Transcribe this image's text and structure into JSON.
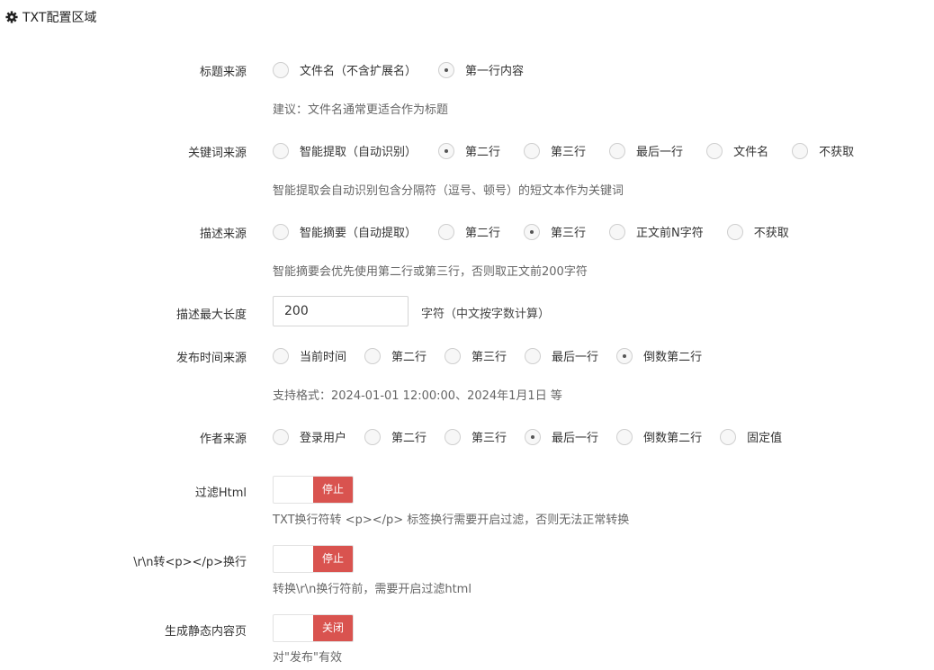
{
  "section": {
    "title": "TXT配置区域",
    "icon": "gear-icon"
  },
  "colors": {
    "accent_red": "#d9534f",
    "help_text": "#666666",
    "label_text": "#333333"
  },
  "title_source": {
    "label": "标题来源",
    "options": [
      {
        "label": "文件名（不含扩展名）",
        "checked": false
      },
      {
        "label": "第一行内容",
        "checked": true
      }
    ],
    "help": "建议：文件名通常更适合作为标题"
  },
  "keyword_source": {
    "label": "关键词来源",
    "options": [
      {
        "label": "智能提取（自动识别）",
        "checked": false
      },
      {
        "label": "第二行",
        "checked": true
      },
      {
        "label": "第三行",
        "checked": false
      },
      {
        "label": "最后一行",
        "checked": false
      },
      {
        "label": "文件名",
        "checked": false
      },
      {
        "label": "不获取",
        "checked": false
      }
    ],
    "help": "智能提取会自动识别包含分隔符（逗号、顿号）的短文本作为关键词"
  },
  "desc_source": {
    "label": "描述来源",
    "options": [
      {
        "label": "智能摘要（自动提取）",
        "checked": false
      },
      {
        "label": "第二行",
        "checked": false
      },
      {
        "label": "第三行",
        "checked": true
      },
      {
        "label": "正文前N字符",
        "checked": false
      },
      {
        "label": "不获取",
        "checked": false
      }
    ],
    "help": "智能摘要会优先使用第二行或第三行，否则取正文前200字符"
  },
  "desc_max_length": {
    "label": "描述最大长度",
    "value": "200",
    "unit": "字符（中文按字数计算）"
  },
  "publish_time_source": {
    "label": "发布时间来源",
    "options": [
      {
        "label": "当前时间",
        "checked": false
      },
      {
        "label": "第二行",
        "checked": false
      },
      {
        "label": "第三行",
        "checked": false
      },
      {
        "label": "最后一行",
        "checked": false
      },
      {
        "label": "倒数第二行",
        "checked": true
      }
    ],
    "help": "支持格式：2024-01-01 12:00:00、2024年1月1日 等"
  },
  "author_source": {
    "label": "作者来源",
    "options": [
      {
        "label": "登录用户",
        "checked": false
      },
      {
        "label": "第二行",
        "checked": false
      },
      {
        "label": "第三行",
        "checked": false
      },
      {
        "label": "最后一行",
        "checked": true
      },
      {
        "label": "倒数第二行",
        "checked": false
      },
      {
        "label": "固定值",
        "checked": false
      }
    ]
  },
  "filter_html": {
    "label": "过滤Html",
    "state": "停止",
    "help": "TXT换行符转 <p></p> 标签换行需要开启过滤，否则无法正常转换"
  },
  "rn_to_p": {
    "label": "\\r\\n转<p></p>换行",
    "state": "停止",
    "help": "转换\\r\\n换行符前，需要开启过滤html"
  },
  "static_page": {
    "label": "生成静态内容页",
    "state": "关闭",
    "help": "对\"发布\"有效"
  }
}
